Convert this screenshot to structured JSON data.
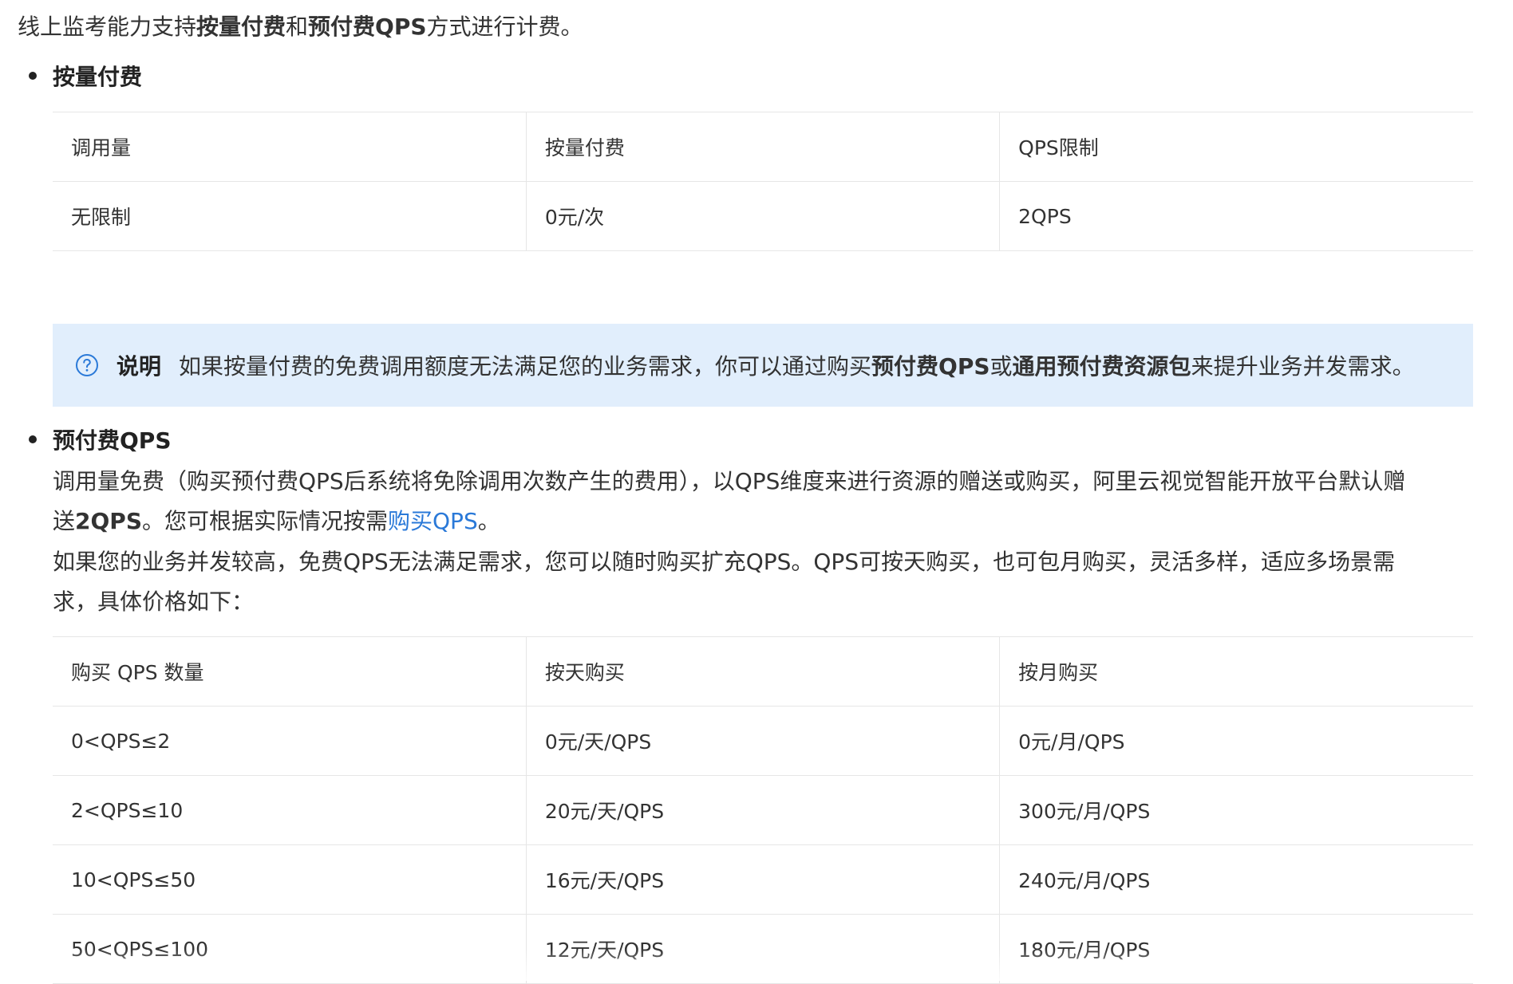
{
  "intro": {
    "p1": "线上监考能力支持",
    "b1": "按量付费",
    "p2": "和",
    "b2": "预付费QPS",
    "p3": "方式进行计费。"
  },
  "section1": {
    "title": "按量付费",
    "table": {
      "headers": [
        "调用量",
        "按量付费",
        "QPS限制"
      ],
      "rows": [
        [
          "无限制",
          "0元/次",
          "2QPS"
        ]
      ]
    }
  },
  "note": {
    "icon": "question-circle-icon",
    "title": "说明",
    "p1": "如果按量付费的免费调用额度无法满足您的业务需求，你可以通过购买",
    "b1": "预付费QPS",
    "p2": "或",
    "b2": "通用预付费资源包",
    "p3": "来提升业务并发需求。"
  },
  "section2": {
    "title": "预付费QPS",
    "para1": {
      "line1": "调用量免费（购买预付费QPS后系统将免除调用次数产生的费用），以QPS维度来进行资源的赠送或购买，阿里云视觉智能开放平台默认赠",
      "line2_a": "送",
      "line2_b": "2QPS",
      "line2_c": "。您可根据实际情况按需",
      "link": "购买QPS",
      "line2_d": "。"
    },
    "para2": {
      "line1": "如果您的业务并发较高，免费QPS无法满足需求，您可以随时购买扩充QPS。QPS可按天购买，也可包月购买，灵活多样，适应多场景需",
      "line2": "求，具体价格如下："
    },
    "table": {
      "headers": [
        "购买 QPS 数量",
        "按天购买",
        "按月购买"
      ],
      "rows": [
        [
          "0<QPS≤2",
          "0元/天/QPS",
          "0元/月/QPS"
        ],
        [
          "2<QPS≤10",
          "20元/天/QPS",
          "300元/月/QPS"
        ],
        [
          "10<QPS≤50",
          "16元/天/QPS",
          "240元/月/QPS"
        ],
        [
          "50<QPS≤100",
          "12元/天/QPS",
          "180元/月/QPS"
        ]
      ]
    }
  },
  "colors": {
    "note_bg": "#e1eefc",
    "link": "#2a79d8",
    "border": "#e6e6e6"
  }
}
